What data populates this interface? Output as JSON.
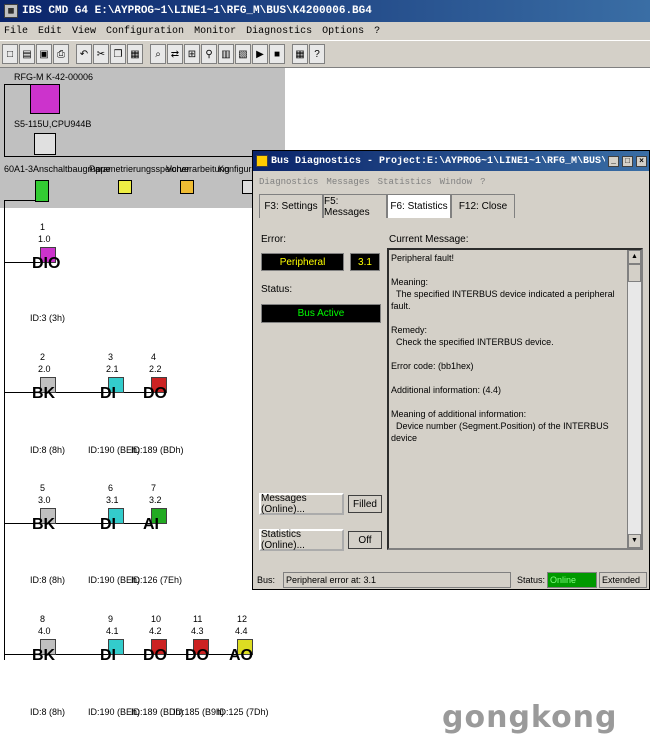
{
  "window": {
    "title": "IBS CMD G4 E:\\AYPROG~1\\LINE1~1\\RFG_M\\BUS\\K4200006.BG4"
  },
  "menu": [
    "File",
    "Edit",
    "View",
    "Configuration",
    "Monitor",
    "Diagnostics",
    "Options",
    "?"
  ],
  "toolbar": {
    "buttons": [
      "new-icon",
      "open-icon",
      "save-icon",
      "print-icon",
      "undo-icon",
      "cut-icon",
      "copy-icon",
      "paste-icon",
      "zoom-icon",
      "connect-icon",
      "tree-icon",
      "find-icon",
      "device-icon",
      "monitor-icon",
      "run-icon",
      "stop-icon",
      "grid-icon",
      "help-icon"
    ]
  },
  "tree": {
    "controller_name": "RFG-M K-42-00006",
    "cpu": "S5-115U,CPU944B",
    "top_nodes": [
      "60A1-3Anschaltbaugruppe",
      "Parametrierungsspeicher",
      "Vorverarbeitung",
      "Konfigurati"
    ],
    "devices": [
      {
        "num": "1",
        "pos": "1.0",
        "label": "DIO",
        "id": "ID:3 (3h)",
        "color": "#cc33cc"
      },
      {
        "num": "2",
        "pos": "2.0",
        "label": "BK",
        "id": "ID:8 (8h)",
        "color": "#c0c0c0"
      },
      {
        "num": "3",
        "pos": "2.1",
        "label": "DI",
        "id": "ID:190 (BEh)",
        "color": "#33cccc"
      },
      {
        "num": "4",
        "pos": "2.2",
        "label": "DO",
        "id": "ID:189 (BDh)",
        "color": "#cc2222"
      },
      {
        "num": "5",
        "pos": "3.0",
        "label": "BK",
        "id": "ID:8 (8h)",
        "color": "#c0c0c0"
      },
      {
        "num": "6",
        "pos": "3.1",
        "label": "DI",
        "id": "ID:190 (BEh)",
        "color": "#33cccc"
      },
      {
        "num": "7",
        "pos": "3.2",
        "label": "AI",
        "id": "ID:126 (7Eh)",
        "color": "#22aa22"
      },
      {
        "num": "8",
        "pos": "4.0",
        "label": "BK",
        "id": "ID:8 (8h)",
        "color": "#c0c0c0"
      },
      {
        "num": "9",
        "pos": "4.1",
        "label": "DI",
        "id": "ID:190 (BEh)",
        "color": "#33cccc"
      },
      {
        "num": "10",
        "pos": "4.2",
        "label": "DO",
        "id": "ID:189 (BDh)",
        "color": "#cc2222"
      },
      {
        "num": "11",
        "pos": "4.3",
        "label": "DO",
        "id": "ID:185 (B9h)",
        "color": "#cc2222"
      },
      {
        "num": "12",
        "pos": "4.4",
        "label": "AO",
        "id": "ID:125 (7Dh)",
        "color": "#dddd22"
      }
    ]
  },
  "dialog": {
    "title": "Bus Diagnostics - Project:E:\\AYPROG~1\\LINE1~1\\RFG_M\\BUS\\K4200006",
    "menu": [
      "Diagnostics",
      "Messages",
      "Statistics",
      "Window",
      "?"
    ],
    "tabs": [
      "F3: Settings",
      "F5: Messages",
      "F6: Statistics",
      "F12: Close"
    ],
    "active_tab": "F6: Statistics",
    "error_label": "Error:",
    "error_value": "Peripheral",
    "error_position": "3.1",
    "status_label": "Status:",
    "status_value": "Bus Active",
    "messages_button": "Messages (Online)...",
    "messages_flag": "Filled",
    "statistics_button": "Statistics (Online)...",
    "statistics_flag": "Off",
    "current_message_label": "Current Message:",
    "message_lines": [
      "Peripheral fault!",
      "",
      "Meaning:",
      "  The specified INTERBUS device indicated a peripheral fault.",
      "",
      "Remedy:",
      "  Check the specified INTERBUS device.",
      "",
      "Error code: (bb1hex)",
      "",
      "Additional information: (4.4)",
      "",
      "Meaning of additional information:",
      "  Device number (Segment.Position) of the INTERBUS device"
    ],
    "statusbar": {
      "bus_label": "Bus:",
      "bus_value": "Peripheral error at: 3.1",
      "status_label": "Status:",
      "status_value": "Online",
      "mode": "Extended"
    }
  },
  "watermark": "gongkong"
}
